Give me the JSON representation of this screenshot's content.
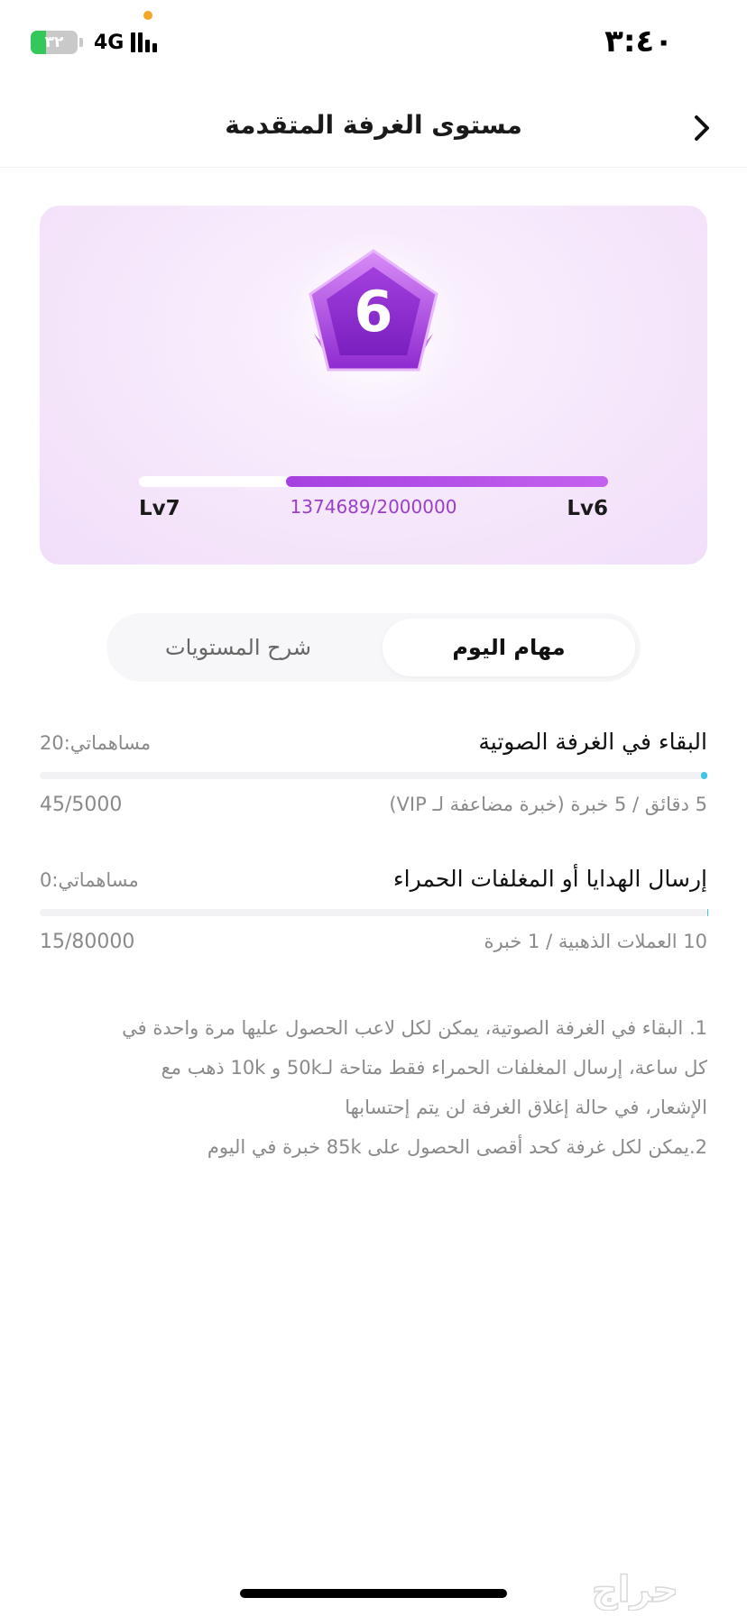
{
  "status_bar": {
    "time": "٣:٤٠",
    "network": "4G",
    "battery_text": "٣٢",
    "battery_level": 0.32,
    "colors": {
      "battery_fill": "#34c759",
      "dot": "#f5a623"
    },
    "icons": [
      "battery-icon",
      "signal-icon"
    ]
  },
  "header": {
    "title": "مستوى الغرفة المتقدمة",
    "back_icon": "chevron-right-icon"
  },
  "level_card": {
    "badge_level": "6",
    "current_level": "Lv6",
    "next_level": "Lv7",
    "xp_text": "1374689/2000000",
    "progress_fraction": 0.687,
    "colors": {
      "progress": "#b24ee6",
      "xp_text": "#9b3fc8"
    }
  },
  "tabs": [
    {
      "label": "مهام اليوم",
      "active": true
    },
    {
      "label": "شرح المستويات",
      "active": false
    }
  ],
  "tasks": [
    {
      "title": "البقاء في الغرفة الصوتية",
      "contribution": "مساهماتي:20",
      "rule": "5 دقائق / 5 خبرة (خبرة مضاعفة لـ VIP)",
      "count": "45/5000",
      "progress_fraction": 0.009
    },
    {
      "title": "إرسال الهدايا أو المغلفات الحمراء",
      "contribution": "مساهماتي:0",
      "rule": "10 العملات الذهبية / 1 خبرة",
      "count": "15/80000",
      "progress_fraction": 0.0002
    }
  ],
  "notes": [
    "1. البقاء في الغرفة الصوتية، يمكن لكل لاعب الحصول عليها مرة واحدة في",
    "كل ساعة، إرسال المغلفات الحمراء فقط متاحة لـ50k و 10k ذهب مع",
    "الإشعار، في حالة إغلاق الغرفة لن يتم إحتسابها",
    "2.يمكن لكل غرفة كحد أقصى الحصول على 85k خبرة في اليوم"
  ],
  "watermark": "حراج"
}
